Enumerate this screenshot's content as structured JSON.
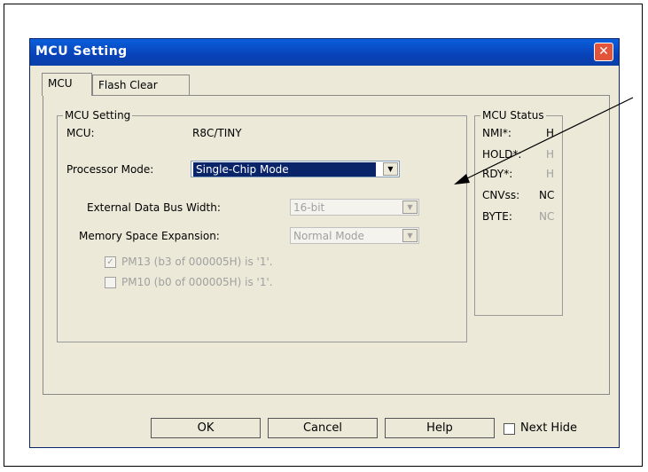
{
  "dialog": {
    "title": "MCU Setting"
  },
  "tabs": [
    {
      "label": "MCU"
    },
    {
      "label": "Flash Clear"
    }
  ],
  "mcu_setting": {
    "legend": "MCU Setting",
    "mcu_label": "MCU:",
    "mcu_value": "R8C/TINY",
    "processor_mode_label": "Processor Mode:",
    "processor_mode_value": "Single-Chip Mode",
    "bus_width_label": "External Data Bus Width:",
    "bus_width_value": "16-bit",
    "mem_exp_label": "Memory Space Expansion:",
    "mem_exp_value": "Normal Mode",
    "pm13_label": "PM13 (b3 of 000005H) is '1'.",
    "pm10_label": "PM10 (b0 of 000005H) is '1'."
  },
  "mcu_status": {
    "legend": "MCU Status",
    "rows": [
      {
        "name": "NMI*:",
        "value": "H"
      },
      {
        "name": "HOLD*:",
        "value": "H"
      },
      {
        "name": "RDY*:",
        "value": "H"
      },
      {
        "name": "CNVss:",
        "value": "NC"
      },
      {
        "name": "BYTE:",
        "value": "NC"
      }
    ]
  },
  "buttons": {
    "ok": "OK",
    "cancel": "Cancel",
    "help": "Help",
    "next_hide": "Next Hide"
  },
  "colors": {
    "title_bar": "#0a5fdc",
    "dialog_bg": "#ece9d8",
    "selection": "#0a246a"
  }
}
